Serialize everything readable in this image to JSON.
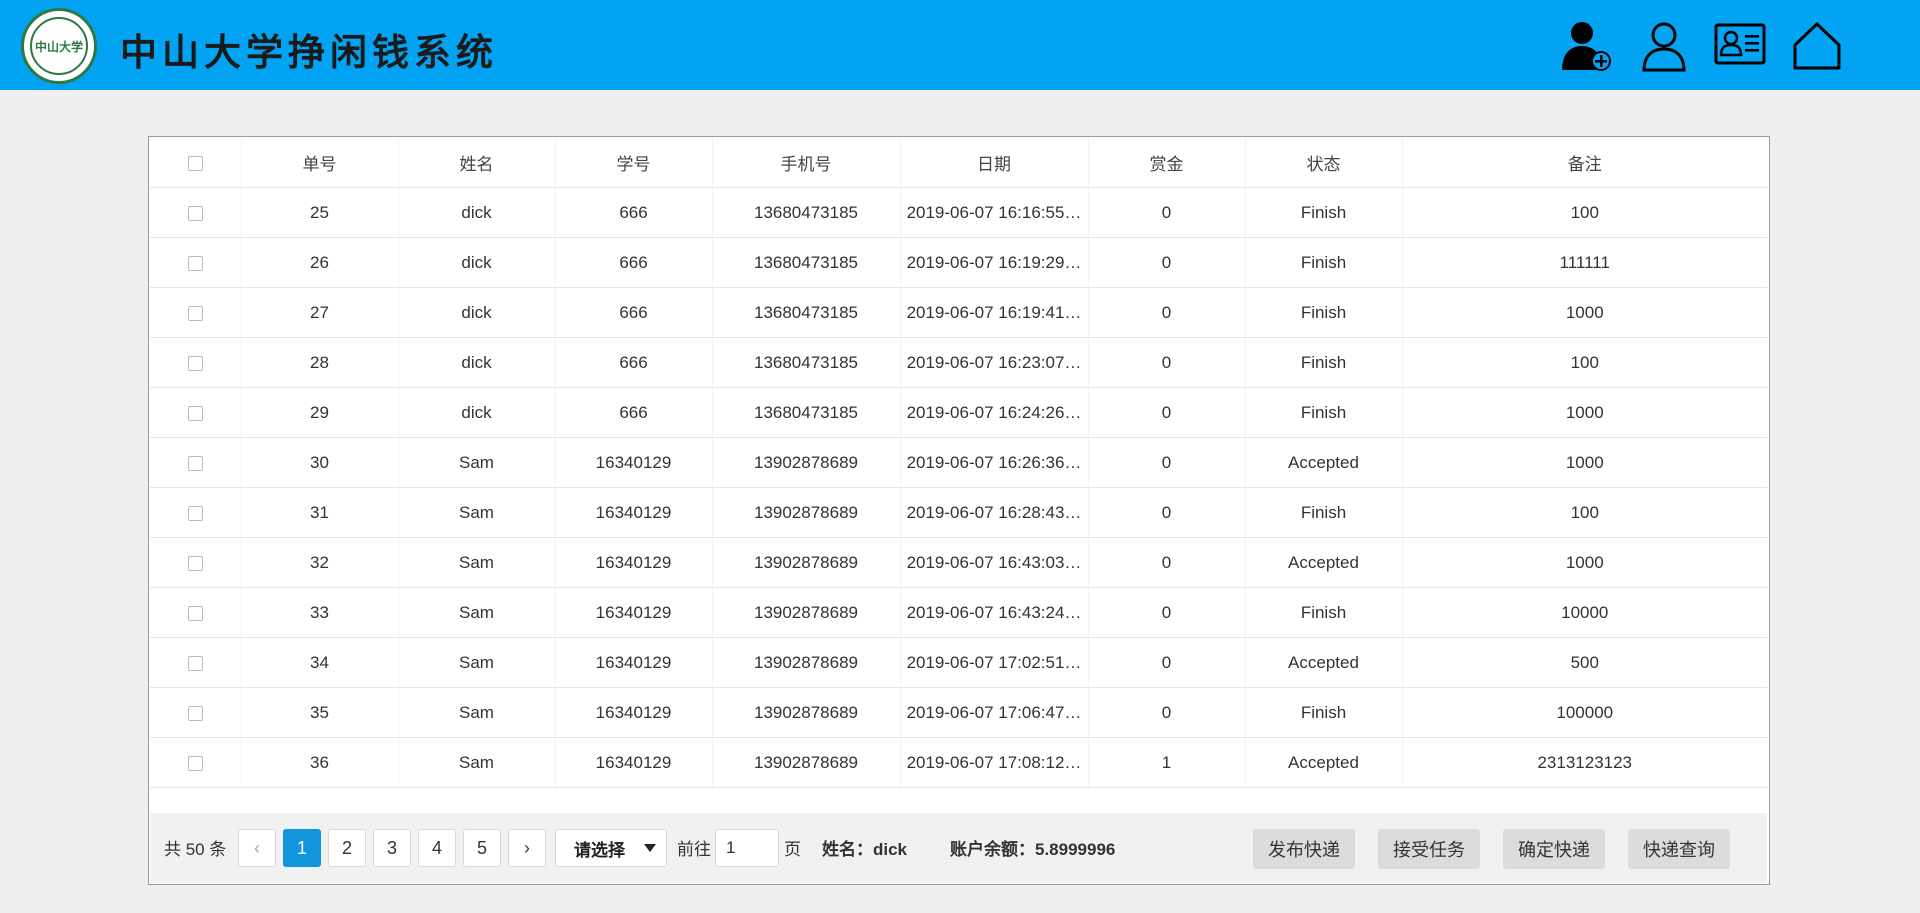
{
  "header": {
    "title": "中山大学挣闲钱系统",
    "logo_text": "中山大学",
    "icons": [
      "add-user-icon",
      "user-icon",
      "id-card-icon",
      "home-icon"
    ],
    "accent": "#02a3f3"
  },
  "table": {
    "columns": [
      "单号",
      "姓名",
      "学号",
      "手机号",
      "日期",
      "赏金",
      "状态",
      "备注"
    ],
    "rows": [
      [
        "25",
        "dick",
        "666",
        "13680473185",
        "2019-06-07 16:16:55…",
        "0",
        "Finish",
        "100"
      ],
      [
        "26",
        "dick",
        "666",
        "13680473185",
        "2019-06-07 16:19:29…",
        "0",
        "Finish",
        "111111"
      ],
      [
        "27",
        "dick",
        "666",
        "13680473185",
        "2019-06-07 16:19:41…",
        "0",
        "Finish",
        "1000"
      ],
      [
        "28",
        "dick",
        "666",
        "13680473185",
        "2019-06-07 16:23:07…",
        "0",
        "Finish",
        "100"
      ],
      [
        "29",
        "dick",
        "666",
        "13680473185",
        "2019-06-07 16:24:26…",
        "0",
        "Finish",
        "1000"
      ],
      [
        "30",
        "Sam",
        "16340129",
        "13902878689",
        "2019-06-07 16:26:36…",
        "0",
        "Accepted",
        "1000"
      ],
      [
        "31",
        "Sam",
        "16340129",
        "13902878689",
        "2019-06-07 16:28:43…",
        "0",
        "Finish",
        "100"
      ],
      [
        "32",
        "Sam",
        "16340129",
        "13902878689",
        "2019-06-07 16:43:03…",
        "0",
        "Accepted",
        "1000"
      ],
      [
        "33",
        "Sam",
        "16340129",
        "13902878689",
        "2019-06-07 16:43:24…",
        "0",
        "Finish",
        "10000"
      ],
      [
        "34",
        "Sam",
        "16340129",
        "13902878689",
        "2019-06-07 17:02:51…",
        "0",
        "Accepted",
        "500"
      ],
      [
        "35",
        "Sam",
        "16340129",
        "13902878689",
        "2019-06-07 17:06:47…",
        "0",
        "Finish",
        "100000"
      ],
      [
        "36",
        "Sam",
        "16340129",
        "13902878689",
        "2019-06-07 17:08:12…",
        "1",
        "Accepted",
        "2313123123"
      ]
    ]
  },
  "pagination": {
    "total_label": "共 50 条",
    "prev": "‹",
    "next": "›",
    "pages": [
      "1",
      "2",
      "3",
      "4",
      "5"
    ],
    "active_page": "1",
    "page_size_select": "请选择",
    "goto_label": "前往",
    "goto_value": "1",
    "page_suffix": "页"
  },
  "account": {
    "name_label": "姓名：dick",
    "balance_label": "账户余额：5.8999996"
  },
  "actions": [
    "发布快递",
    "接受任务",
    "确定快递",
    "快递查询"
  ]
}
